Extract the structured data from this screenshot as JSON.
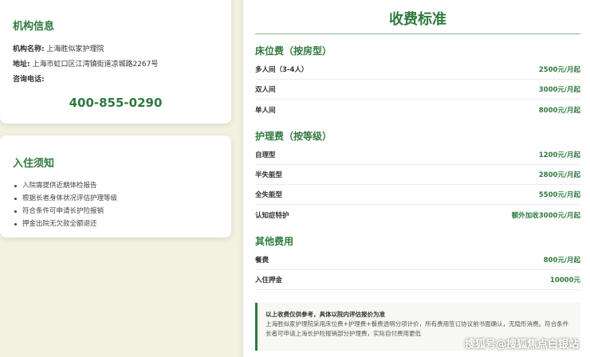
{
  "info": {
    "title": "机构信息",
    "name_label": "机构名称:",
    "name_value": "上海胜似家护理院",
    "address_label": "地址:",
    "address_value": "上海市虹口区江湾镇街道凉城路2267号",
    "phone_label": "咨询电话:",
    "phone": "400-855-0290"
  },
  "notice": {
    "title": "入住须知",
    "items": [
      "入院需提供近期体检报告",
      "根据长者身体状况评估护理等级",
      "符合条件可申请长护险报销",
      "押金出院无欠款全额退还"
    ]
  },
  "fees": {
    "title": "收费标准",
    "bed": {
      "title": "床位费（按房型）",
      "rows": [
        {
          "name": "多人间（3-4人）",
          "price": "2500元/月起"
        },
        {
          "name": "双人间",
          "price": "3000元/月起"
        },
        {
          "name": "单人间",
          "price": "8000元/月起"
        }
      ]
    },
    "care": {
      "title": "护理费（按等级）",
      "rows": [
        {
          "name": "自理型",
          "price": "1200元/月起"
        },
        {
          "name": "半失能型",
          "price": "2800元/月起"
        },
        {
          "name": "全失能型",
          "price": "5500元/月起"
        },
        {
          "name": "认知症特护",
          "price": "额外加收3000元/月起"
        }
      ]
    },
    "other": {
      "title": "其他费用",
      "rows": [
        {
          "name": "餐费",
          "price": "800元/月起"
        },
        {
          "name": "入住押金",
          "price": "10000元"
        }
      ]
    },
    "note_title": "以上收费仅供参考，具体以院内评估报价为准",
    "note_text": "上海胜似家护理院采用床位费+护理费+餐费透明分项计价，所有费用签订协议前书面确认，无隐形消费。符合条件长者可申请上海长护险报销部分护理费，实际自付费用更低"
  },
  "watermark": "搜狐号@搜狐焦点白银站"
}
